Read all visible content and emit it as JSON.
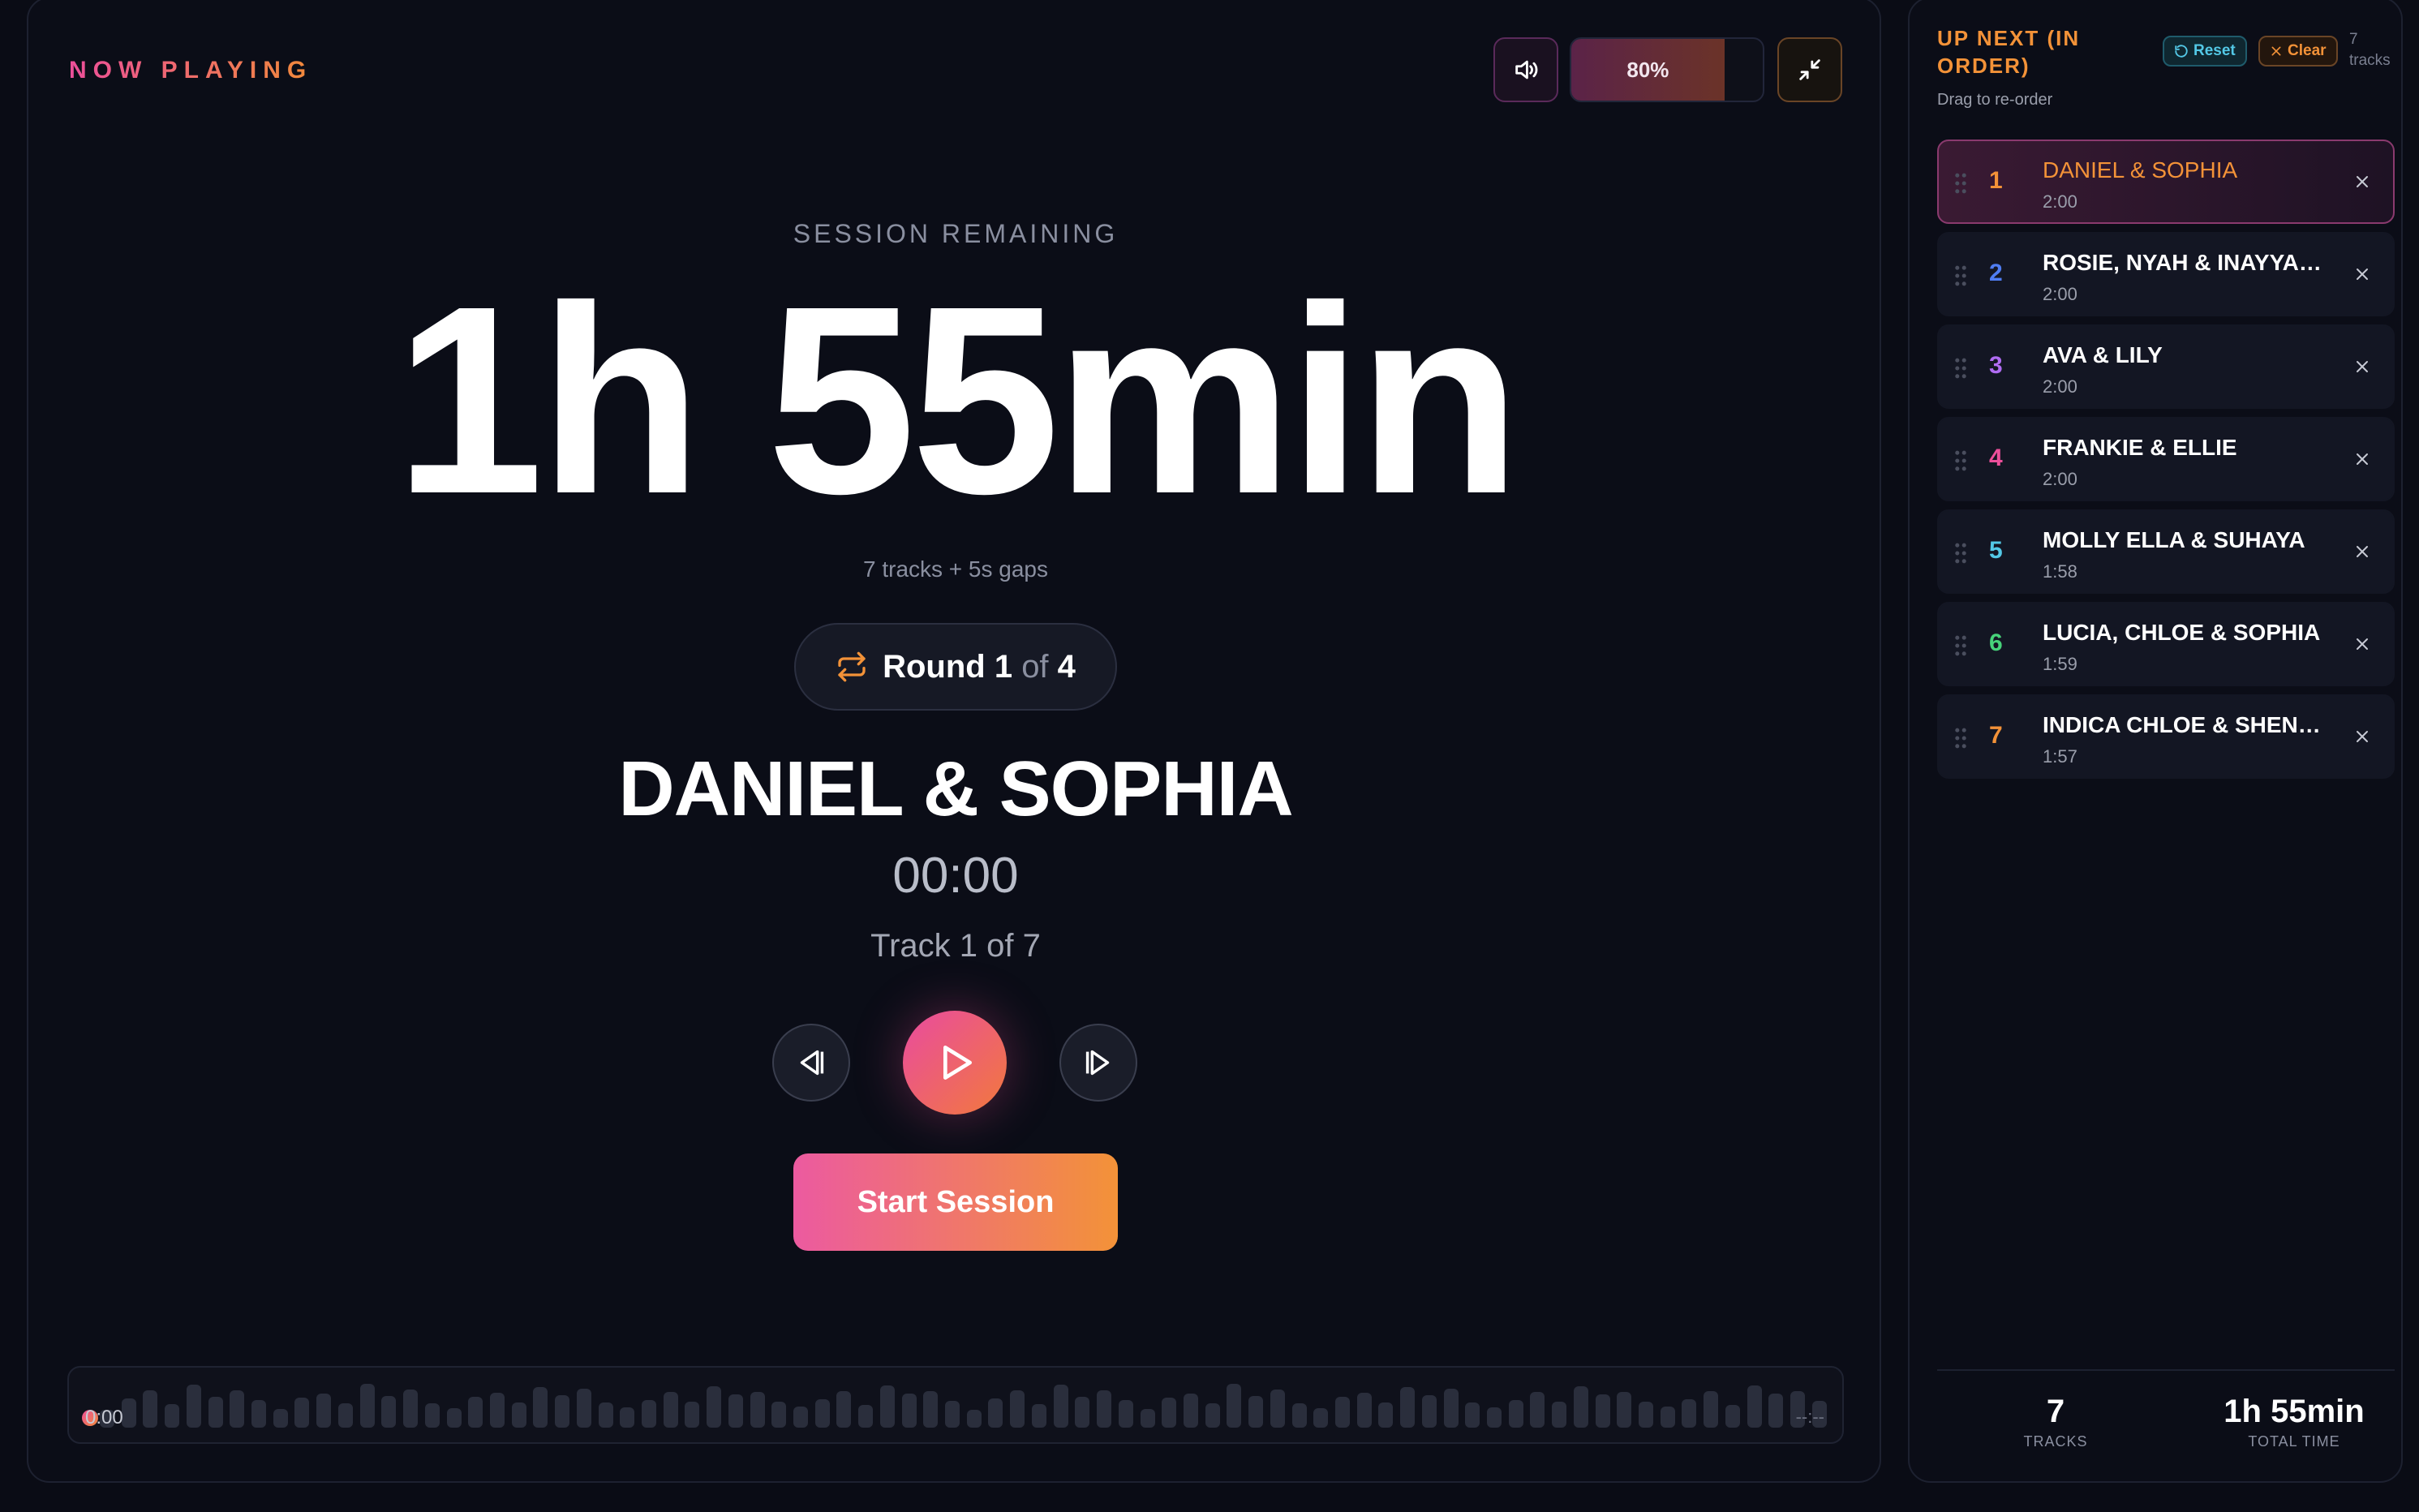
{
  "player": {
    "header_label": "NOW PLAYING",
    "volume_percent": 80,
    "volume_label": "80%",
    "session_label": "SESSION REMAINING",
    "session_remaining": "1h 55min",
    "gaps_info": "7 tracks + 5s gaps",
    "round": {
      "label": "Round",
      "current": "1",
      "of": "of",
      "total": "4"
    },
    "current_track": "DANIEL & SOPHIA",
    "elapsed": "00:00",
    "track_position": "Track 1 of 7",
    "start_button": "Start Session",
    "waveform": {
      "start": "0:00",
      "end": "--:--"
    }
  },
  "queue": {
    "title": "UP NEXT (IN ORDER)",
    "reset_label": "Reset",
    "clear_label": "Clear",
    "track_count": "7 tracks",
    "drag_hint": "Drag to re-order",
    "items": [
      {
        "num": "1",
        "name": "DANIEL & SOPHIA",
        "duration": "2:00",
        "color": "#f39238",
        "active": true
      },
      {
        "num": "2",
        "name": "ROSIE, NYAH & INAYYAH ...",
        "duration": "2:00",
        "color": "#4f7df2",
        "active": false
      },
      {
        "num": "3",
        "name": "AVA & LILY",
        "duration": "2:00",
        "color": "#b06cf2",
        "active": false
      },
      {
        "num": "4",
        "name": "FRANKIE & ELLIE",
        "duration": "2:00",
        "color": "#ec4f9a",
        "active": false
      },
      {
        "num": "5",
        "name": "MOLLY ELLA & SUHAYA",
        "duration": "1:58",
        "color": "#53c8e6",
        "active": false
      },
      {
        "num": "6",
        "name": "LUCIA, CHLOE & SOPHIA",
        "duration": "1:59",
        "color": "#47d37a",
        "active": false
      },
      {
        "num": "7",
        "name": "INDICA CHLOE & SHENALI",
        "duration": "1:57",
        "color": "#f39238",
        "active": false
      }
    ],
    "footer": {
      "tracks_value": "7",
      "tracks_label": "TRACKS",
      "time_value": "1h 55min",
      "time_label": "TOTAL TIME"
    }
  },
  "colors": {
    "accent_pink": "#ec4f9a",
    "accent_orange": "#f28a3a",
    "background": "#0a0c15"
  }
}
